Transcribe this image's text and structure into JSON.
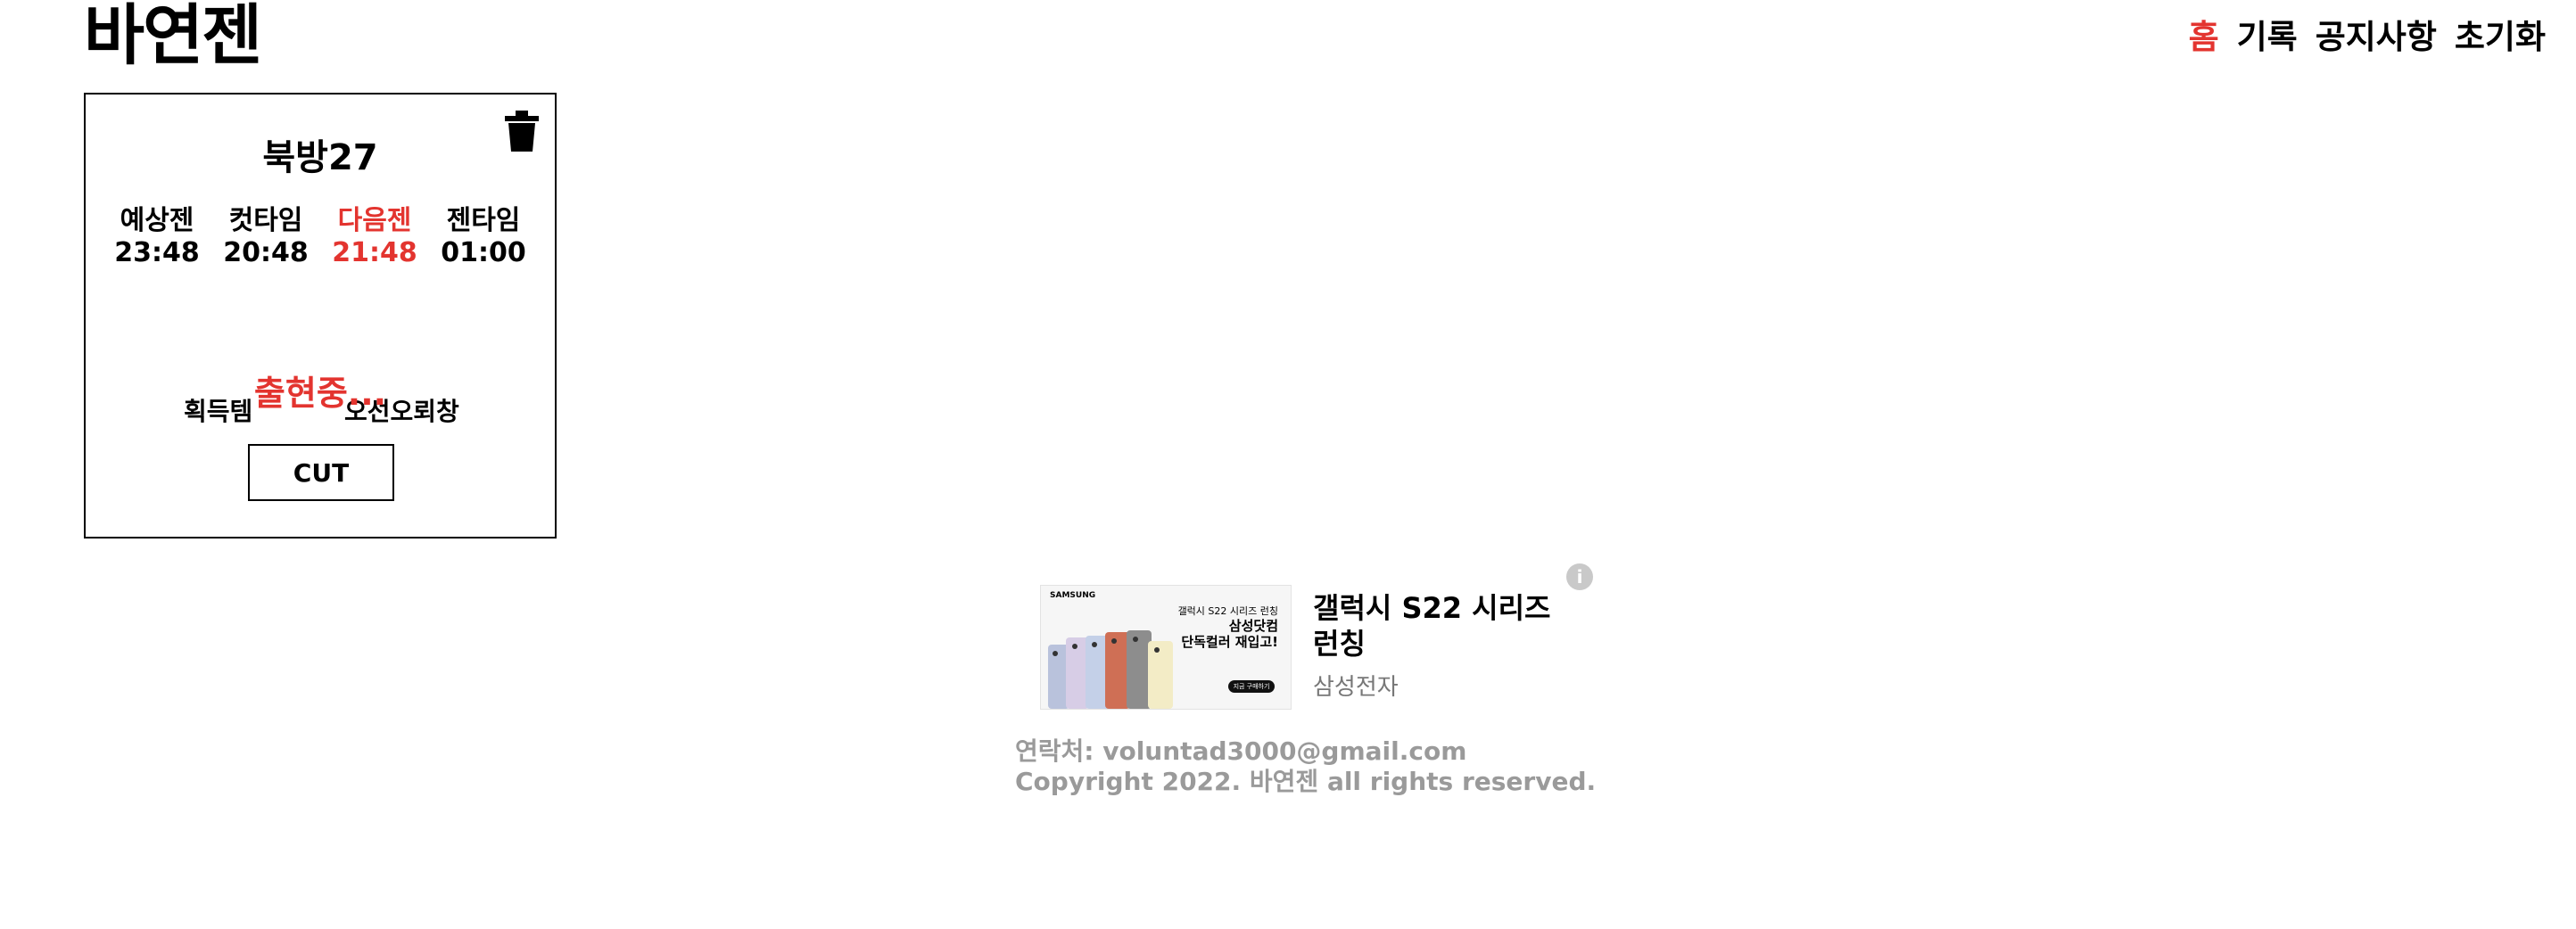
{
  "app": {
    "title": "바연젠"
  },
  "nav": {
    "items": [
      {
        "label": "홈",
        "active": true
      },
      {
        "label": "기록"
      },
      {
        "label": "공지사항"
      },
      {
        "label": "초기화"
      }
    ]
  },
  "card": {
    "title": "북방27",
    "times": [
      {
        "label": "예상젠",
        "value": "23:48"
      },
      {
        "label": "컷타임",
        "value": "20:48"
      },
      {
        "label": "다음젠",
        "value": "21:48"
      },
      {
        "label": "젠타임",
        "value": "01:00"
      }
    ],
    "items": [
      "획득템",
      "오선오뢰창"
    ],
    "status": "출현중...",
    "cut_label": "CUT",
    "trash_icon": "trash-icon"
  },
  "ad": {
    "image_brand": "SAMSUNG",
    "image_line1": "갤럭시 S22 시리즈 런칭",
    "image_line2": "삼성닷컴",
    "image_line3": "단독컬러 재입고!",
    "image_cta": "지금 구매하기",
    "title": "갤럭시 S22 시리즈 런칭",
    "advertiser": "삼성전자",
    "info_icon": "info-icon"
  },
  "footer": {
    "contact": "연락처: voluntad3000@gmail.com",
    "copyright": "Copyright 2022. 바연젠 all rights reserved."
  },
  "colors": {
    "accent": "#e3342f",
    "muted": "#9a9a9a"
  }
}
